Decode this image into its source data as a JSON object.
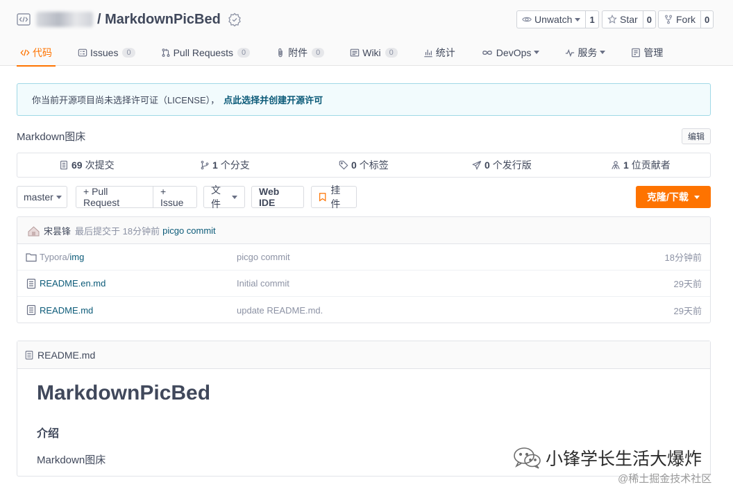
{
  "repo": {
    "title_separator": "/",
    "name": "MarkdownPicBed"
  },
  "actions": {
    "watch": {
      "label": "Unwatch",
      "count": "1"
    },
    "star": {
      "label": "Star",
      "count": "0"
    },
    "fork": {
      "label": "Fork",
      "count": "0"
    }
  },
  "tabs": [
    {
      "label": "代码",
      "badge": null
    },
    {
      "label": "Issues",
      "badge": "0"
    },
    {
      "label": "Pull Requests",
      "badge": "0"
    },
    {
      "label": "附件",
      "badge": "0"
    },
    {
      "label": "Wiki",
      "badge": "0"
    },
    {
      "label": "统计",
      "badge": null
    },
    {
      "label": "DevOps",
      "badge": null
    },
    {
      "label": "服务",
      "badge": null
    },
    {
      "label": "管理",
      "badge": null
    }
  ],
  "notice": {
    "text": "你当前开源项目尚未选择许可证（LICENSE），",
    "link": "点此选择并创建开源许可"
  },
  "description": "Markdown图床",
  "edit_label": "编辑",
  "stats": [
    {
      "count": "69",
      "label": "次提交"
    },
    {
      "count": "1",
      "label": "个分支"
    },
    {
      "count": "0",
      "label": "个标签"
    },
    {
      "count": "0",
      "label": "个发行版"
    },
    {
      "count": "1",
      "label": "位贡献者"
    }
  ],
  "toolbar": {
    "branch": "master",
    "pull_request": "+ Pull Request",
    "issue": "+ Issue",
    "file": "文件",
    "web_ide": "Web IDE",
    "pendant": "挂件",
    "clone": "克隆/下载"
  },
  "last_commit": {
    "author": "宋昙锋",
    "meta": "最后提交于 18分钟前",
    "message": "picgo commit"
  },
  "files": [
    {
      "dir": "Typora/",
      "name": "img",
      "commit": "picgo commit",
      "time": "18分钟前"
    },
    {
      "dir": "",
      "name": "README.en.md",
      "commit": "Initial commit",
      "time": "29天前"
    },
    {
      "dir": "",
      "name": "README.md",
      "commit": "update README.md.",
      "time": "29天前"
    }
  ],
  "readme": {
    "filename": "README.md",
    "h1": "MarkdownPicBed",
    "h3": "介绍",
    "p": "Markdown图床"
  },
  "watermark": {
    "main": "小锋学长生活大爆炸",
    "sub": "@稀土掘金技术社区"
  },
  "colors": {
    "accent": "#fe7300",
    "link": "#0b5a78",
    "notice_bg": "#f2fbfd"
  }
}
